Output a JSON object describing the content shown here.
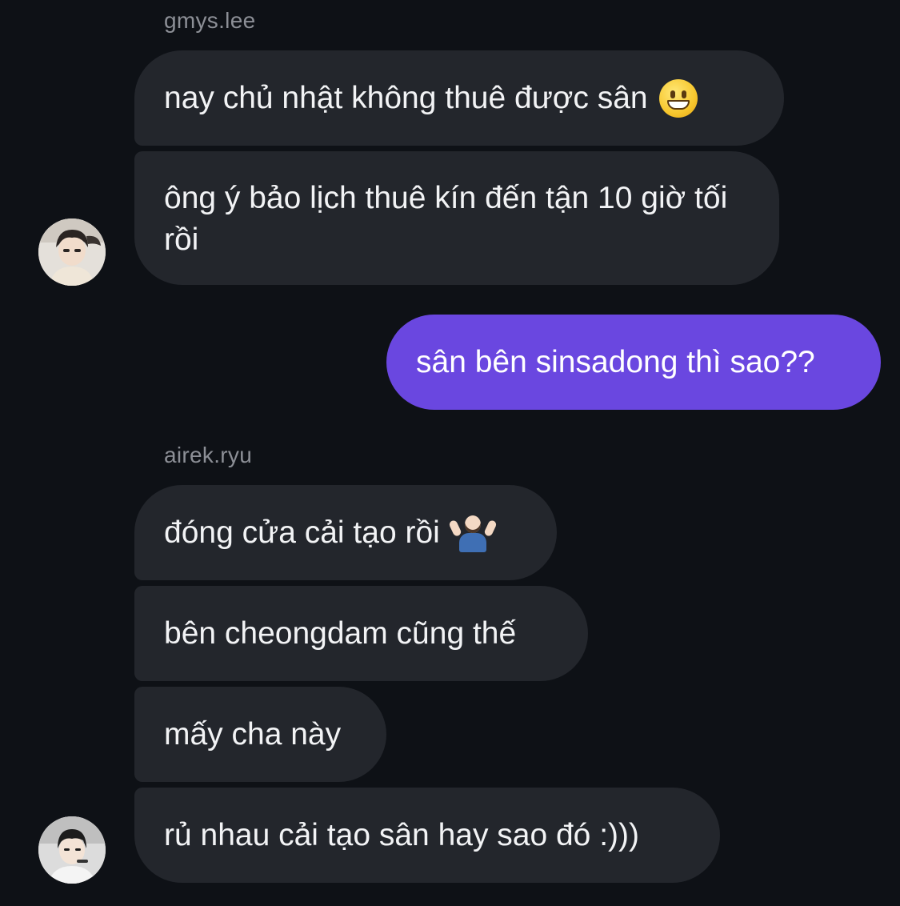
{
  "conversation": {
    "group1": {
      "sender": "gmys.lee",
      "messages": [
        {
          "text": "nay chủ nhật không thuê được sân",
          "emoji": "grinning-face-emoji"
        },
        {
          "text": "ông ý bảo lịch thuê kín đến tận 10 giờ tối rồi"
        }
      ],
      "avatar_icon": "user-avatar-gmys-lee"
    },
    "outgoing": {
      "messages": [
        {
          "text": "sân bên sinsadong thì sao??"
        }
      ],
      "bubble_color": "#6a47e0"
    },
    "group2": {
      "sender": "airek.ryu",
      "messages": [
        {
          "text": "đóng cửa cải tạo rồi",
          "emoji": "person-shrugging-emoji"
        },
        {
          "text": "bên cheongdam cũng thế"
        },
        {
          "text": "mấy cha này"
        },
        {
          "text": "rủ nhau cải tạo sân hay sao đó :)))"
        }
      ],
      "avatar_icon": "user-avatar-airek-ryu"
    }
  },
  "theme": {
    "background": "#0e1116",
    "incoming_bubble": "#23262c",
    "outgoing_bubble": "#6a47e0",
    "sender_name_color": "#8c8f96"
  }
}
